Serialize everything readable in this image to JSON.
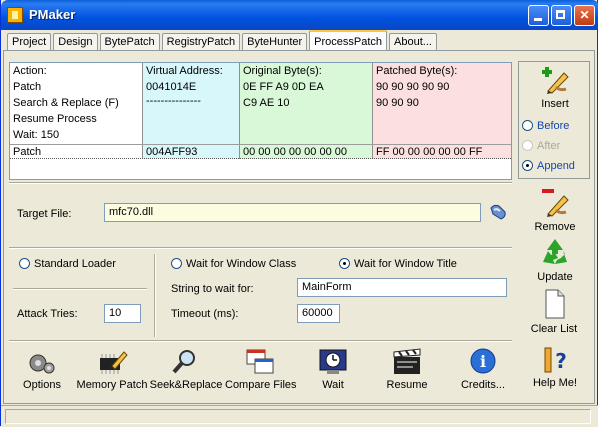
{
  "window": {
    "title": "PMaker"
  },
  "tabs": [
    "Project",
    "Design",
    "BytePatch",
    "RegistryPatch",
    "ByteHunter",
    "ProcessPatch",
    "About..."
  ],
  "active_tab": "ProcessPatch",
  "grid": {
    "col1": [
      "Action:",
      "Patch",
      "Search & Replace (F)",
      "Resume Process",
      "Wait: 150"
    ],
    "col2": [
      "Virtual Address:",
      "0041014E",
      "---------------"
    ],
    "col3": [
      "Original Byte(s):",
      "0E FF A9 0D EA",
      "C9 AE 10"
    ],
    "col4": [
      "Patched Byte(s):",
      "90 90 90 90 90",
      "90 90 90"
    ],
    "selected_row": {
      "action": "Patch",
      "address": "004AFF93",
      "original": "00 00 00 00 00 00 00",
      "patched": "FF 00 00 00 00 00 FF"
    }
  },
  "insert": {
    "label": "Insert",
    "options": [
      "Before",
      "After",
      "Append"
    ],
    "selected": "Append",
    "disabled": "After"
  },
  "side_buttons": {
    "remove": "Remove",
    "update": "Update",
    "clear": "Clear List"
  },
  "target": {
    "label": "Target File:",
    "value": "mfc70.dll"
  },
  "loader": {
    "standard": "Standard Loader",
    "attack_label": "Attack Tries:",
    "attack_value": "10"
  },
  "wait": {
    "class_option": "Wait for Window Class",
    "title_option": "Wait for Window Title",
    "selected": "Wait for Window Title",
    "string_label": "String to wait for:",
    "string_value": "MainForm",
    "timeout_label": "Timeout (ms):",
    "timeout_value": "60000"
  },
  "toolbar": [
    "Options",
    "Memory Patch",
    "Seek&Replace",
    "Compare Files",
    "Wait",
    "Resume",
    "Credits...",
    "Help Me!"
  ],
  "colors": {
    "title_bar": "#0053e0",
    "col_address": "#d8f7fb",
    "col_original": "#d8f8d8",
    "col_patched": "#fce0e0",
    "target_input": "#fcfce0"
  }
}
